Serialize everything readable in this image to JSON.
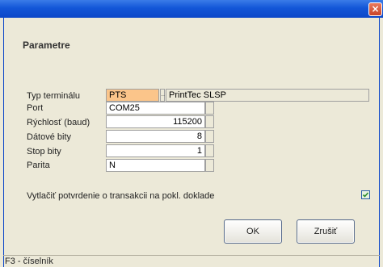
{
  "window": {
    "close_glyph": "×"
  },
  "section": {
    "title": "Parametre"
  },
  "fields": {
    "terminal_type": {
      "label": "Typ terminálu",
      "code": "PTS",
      "name": "PrintTec SLSP"
    },
    "port": {
      "label": "Port",
      "value": "COM25"
    },
    "speed": {
      "label": "Rýchlosť (baud)",
      "value": "115200"
    },
    "data_bits": {
      "label": "Dátové bity",
      "value": "8"
    },
    "stop_bits": {
      "label": "Stop bity",
      "value": "1"
    },
    "parity": {
      "label": "Parita",
      "value": "N"
    }
  },
  "print_option": {
    "label": "Vytlačiť potvrdenie o transakcii na pokl. doklade",
    "checked": true
  },
  "buttons": {
    "ok": "OK",
    "cancel": "Zrušiť"
  },
  "status_bar": {
    "text": "F3 - číselník"
  },
  "colors": {
    "title_bar": "#1356d8",
    "highlight": "#fbc58a",
    "face": "#ece9d8"
  }
}
